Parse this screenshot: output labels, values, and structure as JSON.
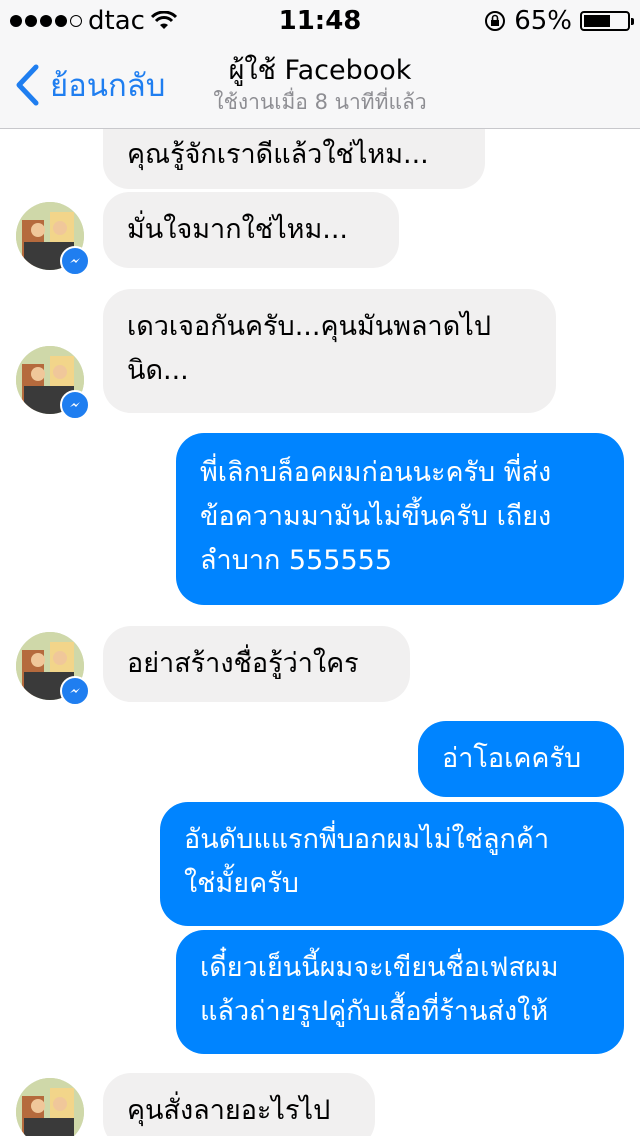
{
  "status": {
    "carrier": "dtac",
    "time": "11:48",
    "battery": "65%",
    "battery_level": 0.65
  },
  "nav": {
    "back_label": "ย้อนกลับ",
    "title": "ผู้ใช้ Facebook",
    "subtitle": "ใช้งานเมื่อ 8 นาทีที่แล้ว"
  },
  "messages": [
    {
      "lines": [
        "คุณรู้จักเราดีแล้วใช่ไหม..."
      ]
    },
    {
      "lines": [
        "มั่นใจมากใช่ไหม..."
      ]
    },
    {
      "lines": [
        "เดวเจอกันครับ...คุนมันพลาดไป",
        "นิด..."
      ]
    },
    {
      "lines": [
        "พี่เลิกบล็อคผมก่อนนะครับ พี่ส่ง",
        "ข้อความมามันไม่ขึ้นครับ เถียง",
        "ลำบาก 555555"
      ]
    },
    {
      "lines": [
        "อย่าสร้างชื่อรู้ว่าใคร"
      ]
    },
    {
      "lines": [
        "อ่าโอเคครับ"
      ]
    },
    {
      "lines": [
        "อันดับแแรกพี่บอกผมไม่ใช่ลูกค้า",
        "ใช่มั้ยครับ"
      ]
    },
    {
      "lines": [
        "เดี๋ยวเย็นนี้ผมจะเขียนชื่อเฟสผม",
        "แล้วถ่ายรูปคู่กับเสื้อที่ร้านส่งให้"
      ]
    },
    {
      "lines": [
        "คุนสั่งลายอะไรไป"
      ]
    }
  ]
}
